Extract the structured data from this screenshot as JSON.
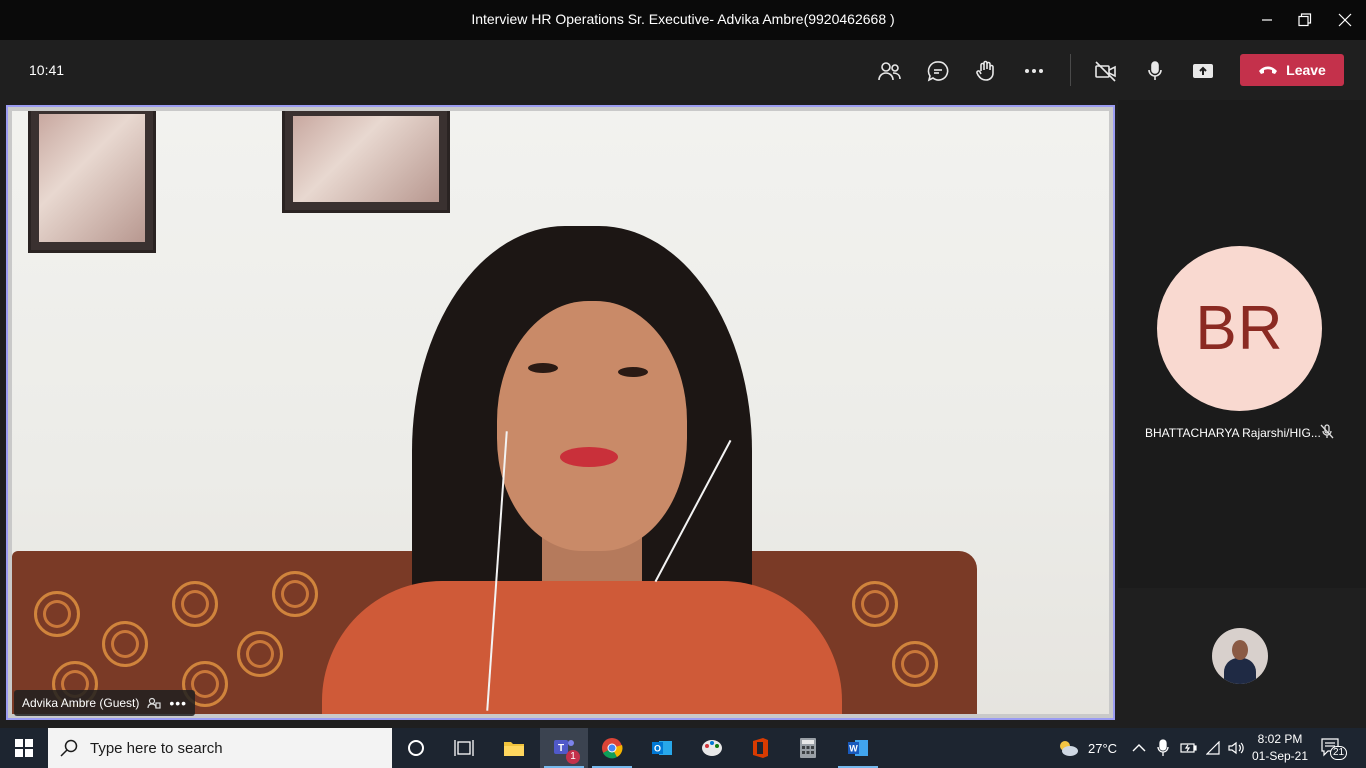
{
  "window": {
    "title": "Interview HR Operations Sr. Executive- Advika Ambre(9920462668 )"
  },
  "toolbar": {
    "elapsed_time": "10:41",
    "leave_label": "Leave"
  },
  "main_video": {
    "participant_label": "Advika Ambre (Guest)"
  },
  "side_panel": {
    "avatar_initials": "BR",
    "participant_name": "BHATTACHARYA Rajarshi/HIG..."
  },
  "taskbar": {
    "search_placeholder": "Type here to search",
    "teams_badge": "1",
    "weather_temp": "27°C",
    "time": "8:02 PM",
    "date": "01-Sep-21",
    "notification_count": "21"
  },
  "colors": {
    "leave_button": "#c4314b",
    "active_speaker_border": "#9b9cf2",
    "avatar_bg": "#f9d9d0",
    "avatar_text": "#8b2a22"
  }
}
